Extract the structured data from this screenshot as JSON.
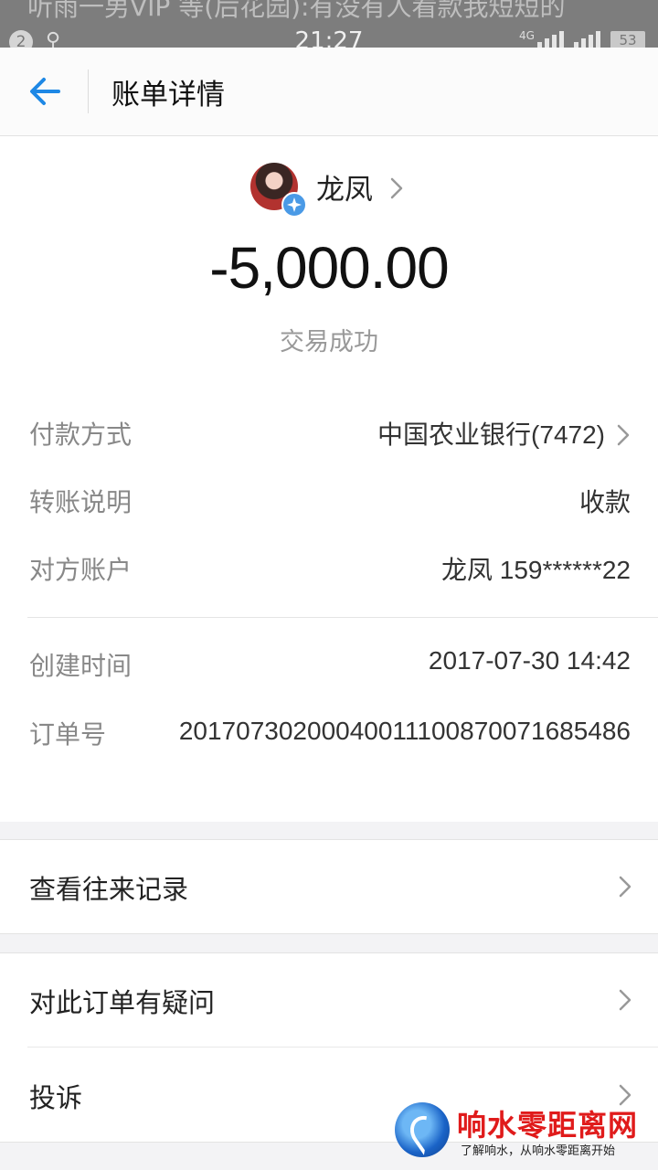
{
  "status_bar": {
    "notification_text": "听雨一男VIP 等(后花园):有没有人看款我短短的",
    "badge": "2",
    "time": "21:27",
    "network": "4G",
    "battery": "53"
  },
  "header": {
    "title": "账单详情"
  },
  "payee": {
    "name": "龙凤"
  },
  "amount": "-5,000.00",
  "status": "交易成功",
  "details": [
    {
      "label": "付款方式",
      "value": "中国农业银行(7472)"
    },
    {
      "label": "转账说明",
      "value": "收款"
    },
    {
      "label": "对方账户",
      "value": "龙凤 159******22"
    },
    {
      "label": "创建时间",
      "value": "2017-07-30 14:42"
    },
    {
      "label": "订单号",
      "value": "20170730200040011100870071685486"
    }
  ],
  "actions": [
    {
      "label": "查看往来记录"
    },
    {
      "label": "对此订单有疑问"
    },
    {
      "label": "投诉"
    }
  ],
  "watermark": {
    "title": "响水零距离网",
    "subtitle": "了解响水，从响水零距离开始"
  },
  "colors": {
    "accent": "#1e88e5",
    "watermark_red": "#e01b1b"
  }
}
